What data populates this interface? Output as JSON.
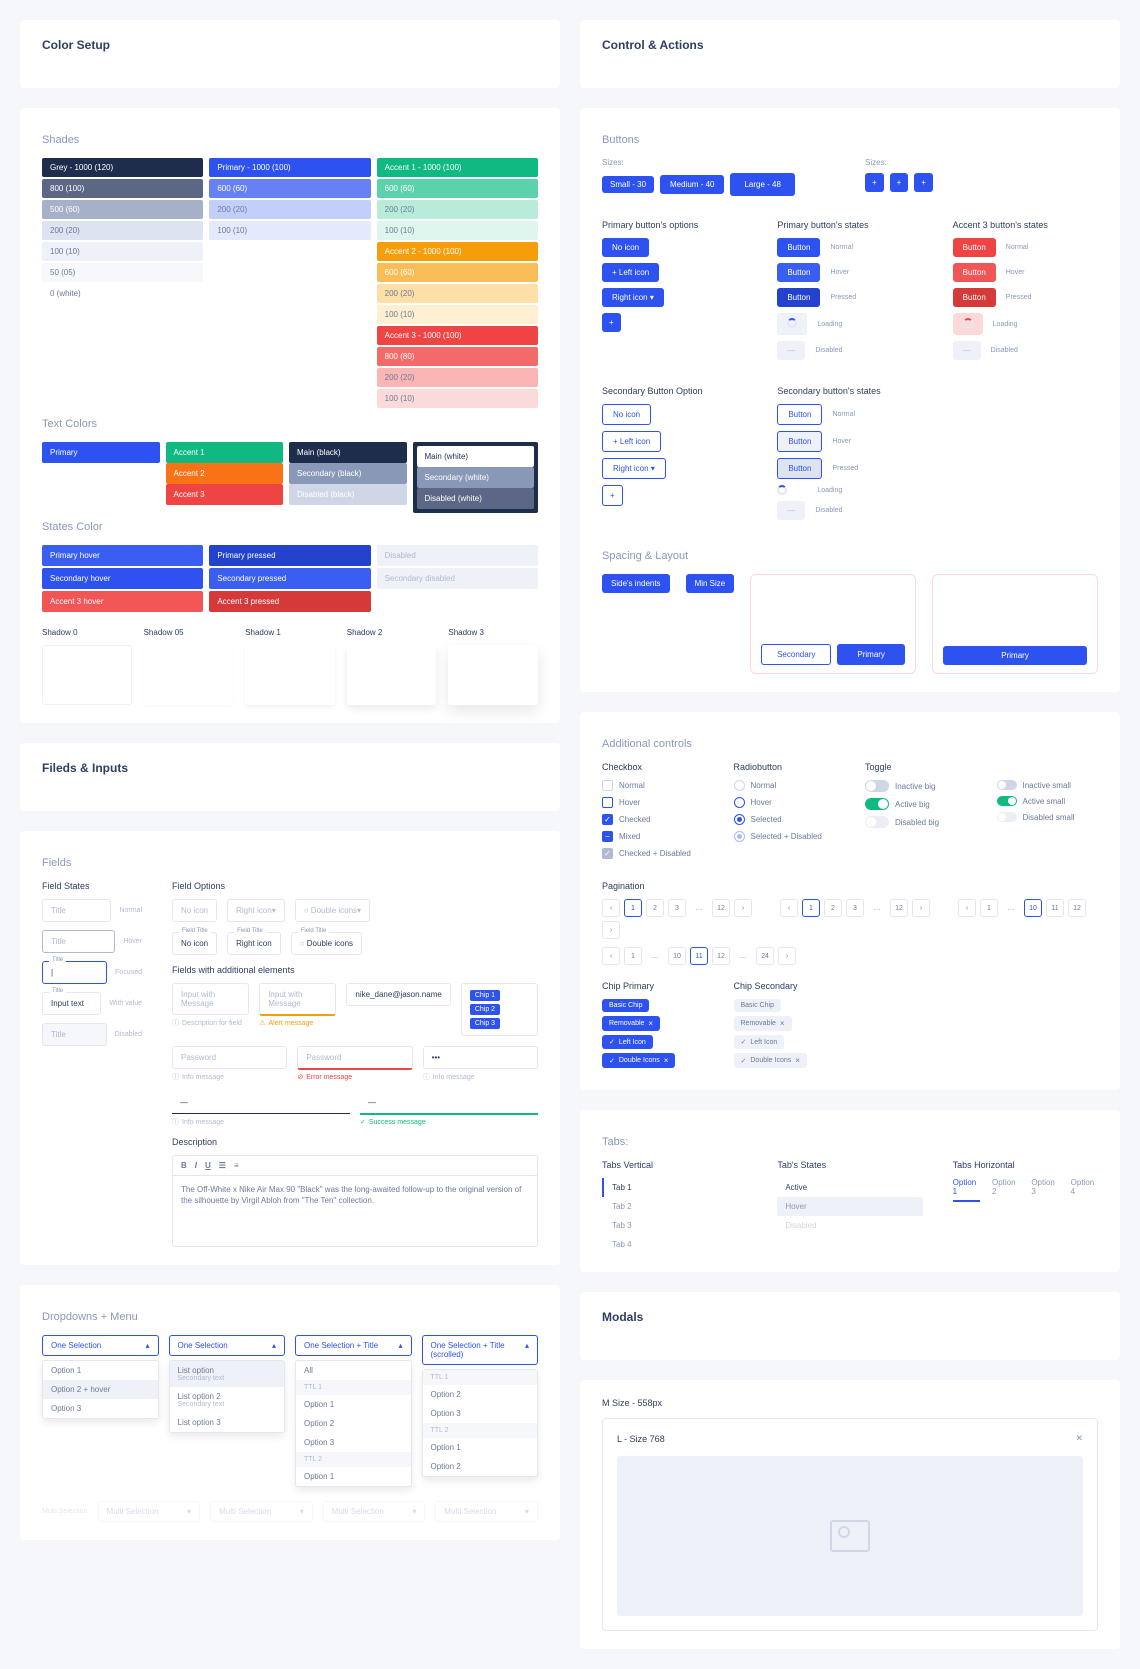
{
  "colorSetup": {
    "title": "Color Setup",
    "shades": {
      "title": "Shades",
      "grey": [
        {
          "label": "Grey - 1000 (120)",
          "bg": "#1f2d4d"
        },
        {
          "label": "800 (100)",
          "bg": "#5b6785",
          "light": false
        },
        {
          "label": "500 (60)",
          "bg": "#a6b0c9",
          "light": false
        },
        {
          "label": "200 (20)",
          "bg": "#dde3ef",
          "light": true
        },
        {
          "label": "100 (10)",
          "bg": "#eef1f7",
          "light": true
        },
        {
          "label": "50 (05)",
          "bg": "#f7f8fb",
          "light": true
        },
        {
          "label": "0 (white)",
          "bg": "#ffffff",
          "light": true
        }
      ],
      "primary": [
        {
          "label": "Primary - 1000 (100)",
          "bg": "#2d52ef"
        },
        {
          "label": "600 (60)",
          "bg": "#6781f4"
        },
        {
          "label": "200 (20)",
          "bg": "#c3cffb",
          "light": true
        },
        {
          "label": "100 (10)",
          "bg": "#e4e9fd",
          "light": true
        }
      ],
      "accent1": [
        {
          "label": "Accent 1 - 1000 (100)",
          "bg": "#10b981"
        },
        {
          "label": "600 (60)",
          "bg": "#5bd1ad"
        },
        {
          "label": "200 (20)",
          "bg": "#b8ecd9",
          "light": true
        },
        {
          "label": "100 (10)",
          "bg": "#def6ee",
          "light": true
        }
      ],
      "accent2": [
        {
          "label": "Accent 2 - 1000 (100)",
          "bg": "#f59e0b"
        },
        {
          "label": "600 (60)",
          "bg": "#f9bd56"
        },
        {
          "label": "200 (20)",
          "bg": "#fddfa7",
          "light": true
        },
        {
          "label": "100 (10)",
          "bg": "#feefd3",
          "light": true
        }
      ],
      "accent3": [
        {
          "label": "Accent 3 - 1000 (100)",
          "bg": "#ef4444"
        },
        {
          "label": "800 (80)",
          "bg": "#f36a6a"
        },
        {
          "label": "200 (20)",
          "bg": "#fbb5b5",
          "light": true
        },
        {
          "label": "100 (10)",
          "bg": "#fddada",
          "light": true
        }
      ]
    },
    "textColors": {
      "title": "Text Colors",
      "primary": "Primary",
      "accents": [
        "Accent 1",
        "Accent 2",
        "Accent 3"
      ],
      "accentColors": [
        "#10b981",
        "#f97316",
        "#ef4444"
      ],
      "main": [
        "Main (black)",
        "Secondary (black)",
        "Disabled (black)"
      ],
      "mainColors": [
        "#1f2d4d",
        "#8a98b8",
        "#cfd6e6"
      ],
      "white": [
        "Main (white)",
        "Secondary (white)",
        "Disabled (white)"
      ],
      "whiteColors": [
        "#ffffff",
        "#8a98b8",
        "#5b6785"
      ]
    },
    "states": {
      "title": "States Color",
      "hover": [
        "Primary hover",
        "Secondary hover",
        "Accent 3 hover"
      ],
      "hoverColors": [
        "#3a5ef2",
        "#2d52ef",
        "#f25555"
      ],
      "pressed": [
        "Primary pressed",
        "Secondary pressed",
        "Accent 3 pressed"
      ],
      "pressedColors": [
        "#2343ce",
        "#3a5ef2",
        "#d63939"
      ],
      "disabled": [
        "Disabled",
        "Secondary disabled"
      ]
    },
    "shadows": [
      "Shadow 0",
      "Shadow 05",
      "Shadow 1",
      "Shadow 2",
      "Shadow 3"
    ]
  },
  "fieldsInputs": {
    "title": "Fileds & Inputs",
    "fieldsTitle": "Fields",
    "fieldStates": "Field States",
    "fieldOptions": "Field Options",
    "fieldsExtra": "Fields with additional elements",
    "states": [
      "Normal",
      "Hover",
      "Focused",
      "With value",
      "Disabled"
    ],
    "titlePh": "Title",
    "inputText": "Input text",
    "noIcon": "No icon",
    "rightIcon": "Right icon",
    "doubleIcons": "Double icons",
    "withMsg": "Input with Message",
    "descHint": "Description for field",
    "alertMsg": "Alert message",
    "email": "nike_dane@jason.name",
    "chips": [
      "Chip 1",
      "Chip 2",
      "Chip 3"
    ],
    "password": "Password",
    "infoMsg": "Info message",
    "errorMsg": "Error message",
    "successMsg": "Success message",
    "descLabel": "Description",
    "rteText": "The Off-White x Nike Air Max 90 \"Black\" was the long-awaited follow-up to the original version of the silhouette by Virgil Abloh from \"The Ten\" collection.",
    "rteBtns": [
      "B",
      "I",
      "U"
    ],
    "ddTitle": "Dropdowns + Menu",
    "oneSelection": "One Selection",
    "oneSelectionTitle": "One Selection + Title",
    "oneSelectionScrolled": "One Selection + Title (scrolled)",
    "options": [
      "Option 1",
      "Option 2 + hover",
      "Option 3"
    ],
    "listOption": "List option",
    "secondaryText": "Secondary text",
    "listOptions": [
      "List option 2",
      "List option 3"
    ],
    "all": "All",
    "ttl1": "TTL 1",
    "ttl2": "TTL 2",
    "opts": [
      "Option 1",
      "Option 2",
      "Option 3"
    ],
    "multiSel": "Multi Selection"
  },
  "controlActions": {
    "title": "Control & Actions",
    "buttons": {
      "title": "Buttons",
      "sizes": "Sizes:",
      "small": "Small - 30",
      "medium": "Medium - 40",
      "large": "Large - 48",
      "primaryOptions": "Primary button's options",
      "primaryStates": "Primary button's states",
      "accent3States": "Accent 3 button's states",
      "noIcon": "No icon",
      "leftIcon": "Left icon",
      "rightIcon": "Right icon",
      "button": "Button",
      "stateLabels": [
        "Normal",
        "Hover",
        "Pressed",
        "Loading",
        "Disabled"
      ],
      "secOption": "Secondary Button Option",
      "secStates": "Secondary button's states"
    },
    "spacing": {
      "title": "Spacing & Layout",
      "sideIndents": "Side's indents",
      "minSize": "Min Size",
      "secondary": "Secondary",
      "primary": "Primary"
    },
    "additional": {
      "title": "Additional controls",
      "checkbox": "Checkbox",
      "radio": "Radiobutton",
      "toggle": "Toggle",
      "cbItems": [
        "Normal",
        "Hover",
        "Checked",
        "Mixed",
        "Checked + Disabled"
      ],
      "radioItems": [
        "Normal",
        "Hover",
        "Selected",
        "Selected + Disabled"
      ],
      "toggleItems": [
        "Inactive big",
        "Active big",
        "Disabled big",
        "Inactive small",
        "Active small",
        "Disabled small"
      ],
      "pagination": "Pagination",
      "pag1": [
        "1",
        "2",
        "3",
        "…",
        "12"
      ],
      "pag2": [
        "1",
        "…",
        "10",
        "11",
        "12"
      ],
      "pag3": [
        "1",
        "…",
        "10",
        "11",
        "12",
        "…",
        "24"
      ],
      "chipPrimary": "Chip Primary",
      "chipSecondary": "Chip Secondary",
      "chips": [
        "Basic Chip",
        "Removable",
        "Left Icon",
        "Double Icons"
      ]
    },
    "tabs": {
      "title": "Tabs:",
      "vertical": "Tabs Vertical",
      "states": "Tab's States",
      "horizontal": "Tabs Horizontal",
      "items": [
        "Tab 1",
        "Tab 2",
        "Tab 3",
        "Tab 4"
      ],
      "stateItems": [
        "Active",
        "Hover",
        "Disabled"
      ],
      "hItems": [
        "Option 1",
        "Option 2",
        "Option 3",
        "Option 4"
      ]
    }
  },
  "modals": {
    "title": "Modals",
    "mSize": "M Size - 558px",
    "lSize": "L - Size  768"
  }
}
